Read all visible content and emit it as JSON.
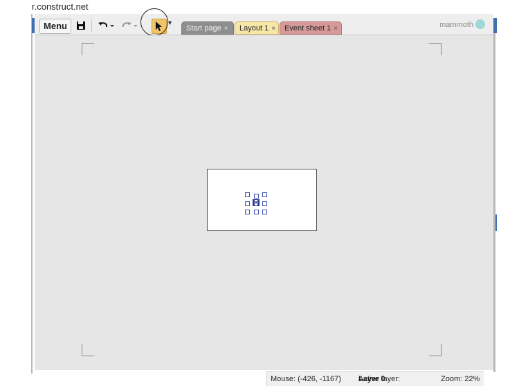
{
  "browser": {
    "url": "r.construct.net"
  },
  "toolbar": {
    "menu_label": "Menu",
    "icons": [
      "save-icon",
      "undo-icon",
      "redo-icon",
      "select-tool-icon"
    ]
  },
  "tabs": [
    {
      "label": "Start page",
      "close": "×",
      "color": "#8e8e8e"
    },
    {
      "label": "Layout 1",
      "close": "×",
      "color": "#f6e7a8",
      "active": true
    },
    {
      "label": "Event sheet 1",
      "close": "×",
      "color": "#d79a9a"
    }
  ],
  "user": {
    "name": "mammoth"
  },
  "status": {
    "mouse": "Mouse: (-426, -1167)",
    "active_layer_label": "Active layer:",
    "active_layer_value": "Layer 0",
    "zoom": "Zoom: 22%"
  },
  "colors": {
    "accent": "#3f6fb0",
    "select_tool": "#f2c46b",
    "selection_handles": "#3b4fb0"
  }
}
